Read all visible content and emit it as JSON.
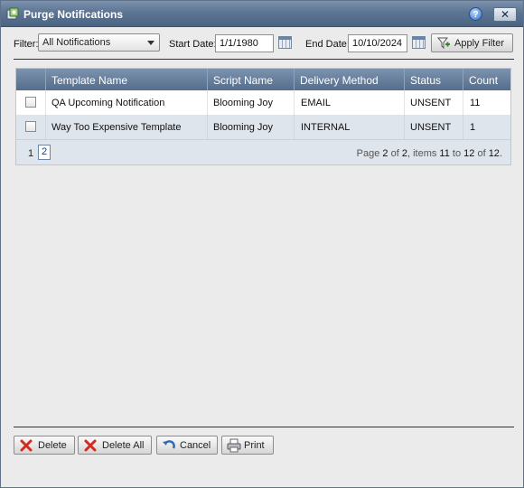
{
  "window": {
    "title": "Purge Notifications",
    "help_glyph": "?",
    "close_glyph": "✕"
  },
  "filter": {
    "label": "Filter:",
    "selected": "All Notifications",
    "start_label": "Start Date:",
    "start_value": "1/1/1980",
    "end_label": "End Date:",
    "end_value": "10/10/2024",
    "apply_label": "Apply Filter"
  },
  "grid": {
    "columns": [
      "Template Name",
      "Script Name",
      "Delivery Method",
      "Status",
      "Count"
    ],
    "rows": [
      {
        "template": "QA Upcoming Notification",
        "script": "Blooming Joy",
        "delivery": "EMAIL",
        "status": "UNSENT",
        "count": "11"
      },
      {
        "template": "Way Too Expensive Template",
        "script": "Blooming Joy",
        "delivery": "INTERNAL",
        "status": "UNSENT",
        "count": "1"
      }
    ],
    "pager": {
      "pages": [
        "1",
        "2"
      ],
      "info_prefix": "Page ",
      "page": "2",
      "of1": " of ",
      "page_total": "2",
      "items_label": ", items ",
      "item_from": "11",
      "to": " to ",
      "item_to": "12",
      "of2": " of ",
      "item_total": "12",
      "suffix": "."
    }
  },
  "actions": {
    "delete": "Delete",
    "delete_all": "Delete All",
    "cancel": "Cancel",
    "print": "Print"
  },
  "colors": {
    "header": "#5c7593",
    "alt_row": "#dfe5ec",
    "delete_icon": "#d42b1e"
  }
}
